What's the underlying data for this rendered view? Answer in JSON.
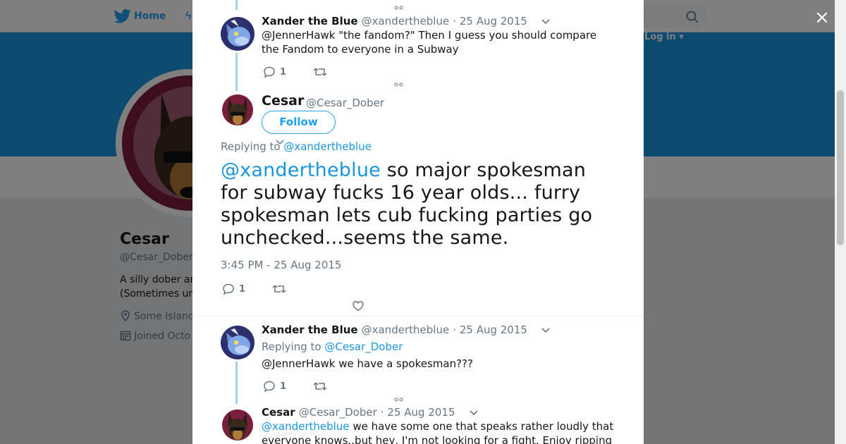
{
  "background": {
    "nav": {
      "home_label": "Home",
      "login_label": "Log in ▾"
    },
    "profile": {
      "name": "Cesar",
      "handle": "@Cesar_Dober",
      "bio_line1": "A silly dober ar",
      "bio_line2": "(Sometimes ur",
      "location": "Some Islanc",
      "joined": "Joined Octo"
    },
    "colors": {
      "banner": "#1b95e0",
      "accent": "#1da1f2"
    }
  },
  "modal": {
    "close_icon": "×",
    "tweets": [
      {
        "name": "Xander the Blue",
        "handle": "@xandertheblue",
        "time": "· 25 Aug 2015",
        "text": "@JennerHawk \"the fandom?\" Then I guess you should compare the Fandom to everyone in a Subway",
        "reply_count": "1"
      },
      {
        "name": "Xander the Blue",
        "handle": "@xandertheblue",
        "time": "· 25 Aug 2015",
        "replying_prefix": "Replying to",
        "replying_to": "@Cesar_Dober",
        "text": "@JennerHawk we have a spokesman???",
        "reply_count": "1"
      },
      {
        "name": "Cesar",
        "handle": "@Cesar_Dober",
        "time": "· 25 Aug 2015",
        "mention": "@xandertheblue",
        "text_after_mention": " we have some one that speaks rather loudly that",
        "text_line2": "everyone knows..but hey, I'm not looking for a fight. Enjoy ripping"
      }
    ],
    "main_tweet": {
      "name": "Cesar",
      "handle": "@Cesar_Dober",
      "follow_label": "Follow",
      "replying_prefix": "Replying to",
      "replying_to": "@xandertheblue",
      "mention": "@xandertheblue",
      "text": " so major spokesman for subway fucks 16 year olds... furry spokesman lets cub fucking parties go unchecked...seems the same.",
      "timestamp": "3:45 PM - 25 Aug 2015",
      "reply_count": "1"
    },
    "colors": {
      "link": "#1b95e0",
      "thread_line": "#9fd3f5"
    }
  }
}
